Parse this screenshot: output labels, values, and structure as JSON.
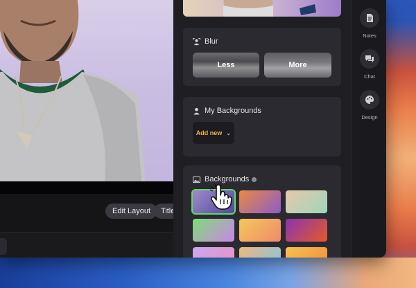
{
  "controls": {
    "edit_layout": "Edit Layout",
    "title_pill": "Title"
  },
  "panel": {
    "blur": {
      "title": "Blur",
      "options": [
        "Less",
        "More"
      ]
    },
    "my_backgrounds": {
      "title": "My Backgrounds",
      "add_new": "Add new"
    },
    "backgrounds": {
      "title": "Backgrounds",
      "selected_index": 0,
      "tile_colors": [
        [
          "#9f8ac8",
          "#4f4a9e"
        ],
        [
          "#e88a45",
          "#8d5cc8"
        ],
        [
          "#e6c8ad",
          "#9fd6b8"
        ],
        [
          "#7fdc76",
          "#c987e8"
        ],
        [
          "#f5c85a",
          "#f08a6c"
        ],
        [
          "#8a34b0",
          "#e35a2a"
        ],
        [
          "#c9a8f0",
          "#ef8fbf"
        ],
        [
          "#f0b77a",
          "#7fc6e8"
        ],
        [
          "#f6c24f",
          "#f08d3e"
        ]
      ]
    }
  },
  "rail": {
    "items": [
      {
        "label": "Notes",
        "icon": "notes-icon"
      },
      {
        "label": "Chat",
        "icon": "chat-icon"
      },
      {
        "label": "Design",
        "icon": "palette-icon"
      }
    ]
  },
  "colors": {
    "accent": "#f3b24b",
    "selected_outline": "#63d86c"
  }
}
